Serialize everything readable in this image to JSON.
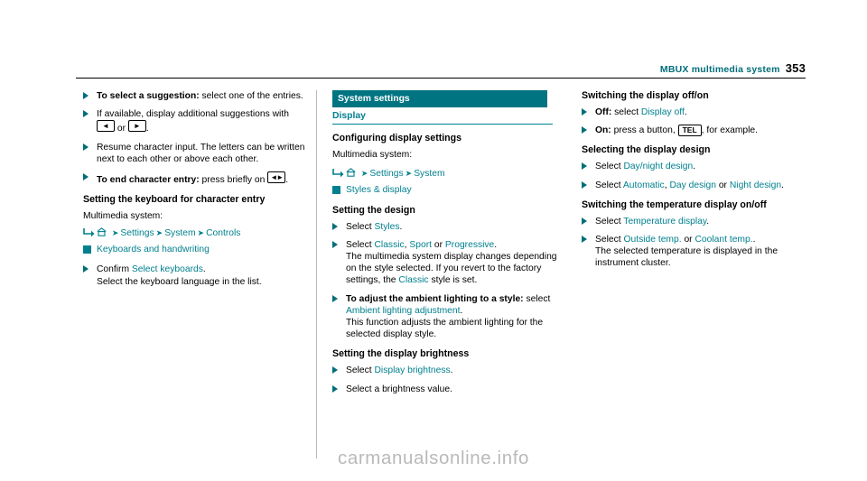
{
  "header": {
    "title": "MBUX multimedia system",
    "page_number": "353"
  },
  "col1": {
    "items": [
      {
        "type": "bullet",
        "parts": [
          {
            "t": "bold",
            "v": "To select a suggestion:"
          },
          {
            "t": "plain",
            "v": " select one of the entries."
          }
        ]
      },
      {
        "type": "bullet",
        "parts": [
          {
            "t": "plain",
            "v": "If available, display additional suggestions with "
          },
          {
            "t": "key-left",
            "v": "◄"
          },
          {
            "t": "plain",
            "v": " or "
          },
          {
            "t": "key-right",
            "v": "►"
          },
          {
            "t": "plain",
            "v": "."
          }
        ]
      },
      {
        "type": "bullet",
        "parts": [
          {
            "t": "plain",
            "v": "Resume character input. The letters can be written next to each other or above each other."
          }
        ]
      },
      {
        "type": "bullet",
        "parts": [
          {
            "t": "bold",
            "v": "To end character entry:"
          },
          {
            "t": "plain",
            "v": " press briefly on "
          },
          {
            "t": "key-back",
            "v": "◄►"
          },
          {
            "t": "plain",
            "v": "."
          }
        ]
      }
    ],
    "section_heading": "Setting the keyboard for character entry",
    "multimedia_label": "Multimedia system:",
    "path1": {
      "lead": "arrow-enter-icon",
      "home": "home-icon",
      "steps": [
        "Settings",
        "System",
        "Controls"
      ]
    },
    "path2": {
      "lead": "square-icon",
      "label": "Keyboards and handwriting"
    },
    "confirm": {
      "prefix": "Confirm ",
      "link": "Select keyboards",
      "suffix": "."
    },
    "confirm_note": "Select the keyboard language in the list."
  },
  "col2": {
    "banner": "System settings",
    "subhead": "Display",
    "config_heading": "Configuring display settings",
    "multimedia_label": "Multimedia system:",
    "path1": {
      "lead": "arrow-enter-icon",
      "home": "home-icon",
      "steps": [
        "Settings",
        "System"
      ]
    },
    "path2": {
      "lead": "square-icon",
      "label": "Styles & display"
    },
    "design_heading": "Setting the design",
    "design_items": [
      {
        "type": "bullet",
        "parts": [
          {
            "t": "plain",
            "v": "Select "
          },
          {
            "t": "link",
            "v": "Styles"
          },
          {
            "t": "plain",
            "v": "."
          }
        ]
      },
      {
        "type": "bullet",
        "parts": [
          {
            "t": "plain",
            "v": "Select "
          },
          {
            "t": "link",
            "v": "Classic"
          },
          {
            "t": "plain",
            "v": ", "
          },
          {
            "t": "link",
            "v": "Sport"
          },
          {
            "t": "plain",
            "v": " or "
          },
          {
            "t": "link",
            "v": "Progressive"
          },
          {
            "t": "plain",
            "v": "."
          }
        ],
        "note_parts": [
          {
            "t": "plain",
            "v": "The multimedia system display changes depending on the style selected. If you revert to the factory settings, the "
          },
          {
            "t": "link",
            "v": "Classic"
          },
          {
            "t": "plain",
            "v": " style is set."
          }
        ]
      },
      {
        "type": "bullet",
        "parts": [
          {
            "t": "bold",
            "v": "To adjust the ambient lighting to a style:"
          },
          {
            "t": "plain",
            "v": " select "
          },
          {
            "t": "link",
            "v": "Ambient lighting adjustment"
          },
          {
            "t": "plain",
            "v": "."
          }
        ],
        "note_parts": [
          {
            "t": "plain",
            "v": "This function adjusts the ambient lighting for the selected display style."
          }
        ]
      }
    ],
    "brightness_heading": "Setting the display brightness",
    "brightness_items": [
      {
        "type": "bullet",
        "parts": [
          {
            "t": "plain",
            "v": "Select "
          },
          {
            "t": "link",
            "v": "Display brightness"
          },
          {
            "t": "plain",
            "v": "."
          }
        ]
      },
      {
        "type": "bullet",
        "parts": [
          {
            "t": "plain",
            "v": "Select a brightness value."
          }
        ]
      }
    ]
  },
  "col3": {
    "onoff_heading": "Switching the display off/on",
    "onoff_items": [
      {
        "type": "bullet",
        "parts": [
          {
            "t": "bold",
            "v": "Off:"
          },
          {
            "t": "plain",
            "v": " select "
          },
          {
            "t": "link",
            "v": "Display off"
          },
          {
            "t": "plain",
            "v": "."
          }
        ]
      },
      {
        "type": "bullet",
        "parts": [
          {
            "t": "bold",
            "v": "On:"
          },
          {
            "t": "plain",
            "v": " press a button, "
          },
          {
            "t": "key-tel",
            "v": "TEL"
          },
          {
            "t": "plain",
            "v": ", for example."
          }
        ]
      }
    ],
    "design_heading": "Selecting the display design",
    "design_items": [
      {
        "type": "bullet",
        "parts": [
          {
            "t": "plain",
            "v": "Select "
          },
          {
            "t": "link",
            "v": "Day/night design"
          },
          {
            "t": "plain",
            "v": "."
          }
        ]
      },
      {
        "type": "bullet",
        "parts": [
          {
            "t": "plain",
            "v": "Select "
          },
          {
            "t": "link",
            "v": "Automatic"
          },
          {
            "t": "plain",
            "v": ", "
          },
          {
            "t": "link",
            "v": "Day design"
          },
          {
            "t": "plain",
            "v": " or "
          },
          {
            "t": "link",
            "v": "Night design"
          },
          {
            "t": "plain",
            "v": "."
          }
        ]
      }
    ],
    "temp_heading": "Switching the temperature display on/off",
    "temp_items": [
      {
        "type": "bullet",
        "parts": [
          {
            "t": "plain",
            "v": "Select "
          },
          {
            "t": "link",
            "v": "Temperature display"
          },
          {
            "t": "plain",
            "v": "."
          }
        ]
      },
      {
        "type": "bullet",
        "parts": [
          {
            "t": "plain",
            "v": "Select "
          },
          {
            "t": "link",
            "v": "Outside temp."
          },
          {
            "t": "plain",
            "v": " or "
          },
          {
            "t": "link",
            "v": "Coolant temp."
          },
          {
            "t": "plain",
            "v": "."
          }
        ],
        "note_parts": [
          {
            "t": "plain",
            "v": "The selected temperature is displayed in the instrument cluster."
          }
        ]
      }
    ]
  },
  "watermark": "carmanualsonline.info",
  "colors": {
    "teal": "#00808e",
    "banner": "#007481",
    "rule": "#b9b9b9"
  }
}
